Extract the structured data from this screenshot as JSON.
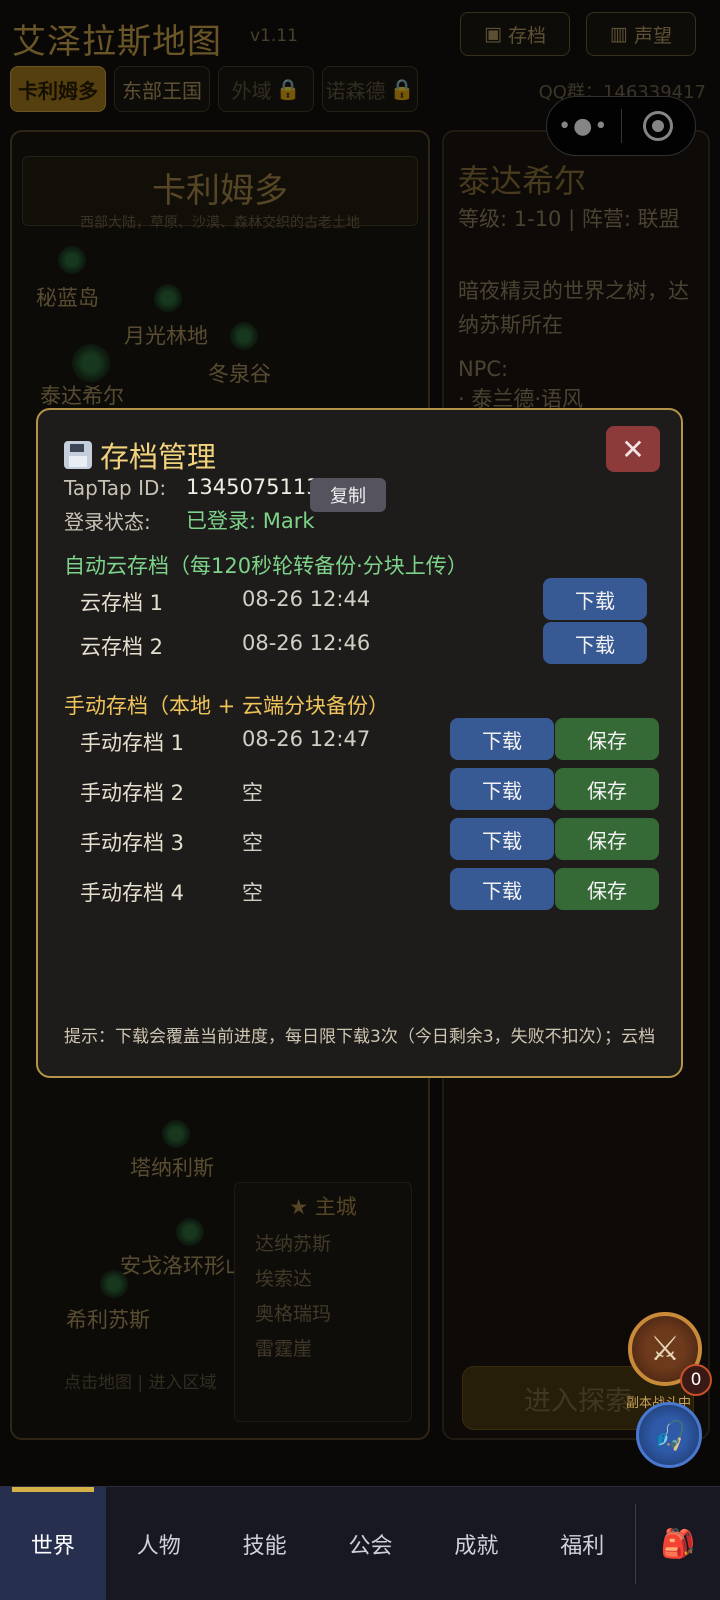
{
  "app": {
    "title": "艾泽拉斯地图",
    "version": "v1.11",
    "archive_btn": "存档",
    "reputation_btn": "声望",
    "qq": "QQ群：146339417"
  },
  "regions": [
    {
      "label": "卡利姆多",
      "state": "active"
    },
    {
      "label": "东部王国",
      "state": "normal"
    },
    {
      "label": "外域",
      "state": "locked"
    },
    {
      "label": "诺森德",
      "state": "locked"
    }
  ],
  "map": {
    "zone_title": "卡利姆多",
    "zone_desc": "西部大陆，草原、沙漠、森林交织的古老土地",
    "nodes": [
      "秘蓝岛",
      "月光林地",
      "冬泉谷",
      "泰达希尔",
      "塔纳利斯",
      "安戈洛环形山",
      "希利苏斯"
    ],
    "capital_title": "★ 主城",
    "capitals": [
      "达纳苏斯",
      "埃索达",
      "奥格瑞玛",
      "雷霆崖"
    ],
    "footer_hint": "点击地图 | 进入区域"
  },
  "info": {
    "zone_name": "泰达希尔",
    "level": "等级: 1-10 | 阵营: 联盟",
    "desc": "暗夜精灵的世界之树，达纳苏斯所在",
    "npc_label": "NPC:",
    "npc_first": "· 泰兰德·语风",
    "explore_btn": "进入探索"
  },
  "floating": {
    "battle_badge": "0",
    "battle_label": "副本战斗中"
  },
  "nav": {
    "items": [
      "世界",
      "人物",
      "技能",
      "公会",
      "成就",
      "福利"
    ],
    "active": "世界"
  },
  "modal": {
    "title": "存档管理",
    "taptap_label": "TapTap ID:",
    "taptap_id": "1345075113",
    "copy_btn": "复制",
    "login_label": "登录状态:",
    "login_value": "已登录: Mark",
    "auto_section": "自动云存档（每120秒轮转备份·分块上传）",
    "auto_slots": [
      {
        "name": "云存档 1",
        "time": "08-26 12:44",
        "download": "下载"
      },
      {
        "name": "云存档 2",
        "time": "08-26 12:46",
        "download": "下载"
      }
    ],
    "manual_section": "手动存档（本地 + 云端分块备份）",
    "manual_slots": [
      {
        "name": "手动存档 1",
        "time": "08-26 12:47",
        "download": "下载",
        "save": "保存"
      },
      {
        "name": "手动存档 2",
        "time": "空",
        "download": "下载",
        "save": "保存"
      },
      {
        "name": "手动存档 3",
        "time": "空",
        "download": "下载",
        "save": "保存"
      },
      {
        "name": "手动存档 4",
        "time": "空",
        "download": "下载",
        "save": "保存"
      }
    ],
    "tip": "提示：下载会覆盖当前进度，每日限下载3次（今日剩余3，失败不扣次）；云档",
    "close_icon": "close-icon"
  },
  "colors": {
    "gold_border": "#b59348",
    "title_gold": "#f0d37c",
    "auto_green": "#7ed38a",
    "manual_yellow": "#f0c45a",
    "download_blue": "#375a95",
    "save_green": "#356a37",
    "close_red": "#8c3a3a"
  }
}
